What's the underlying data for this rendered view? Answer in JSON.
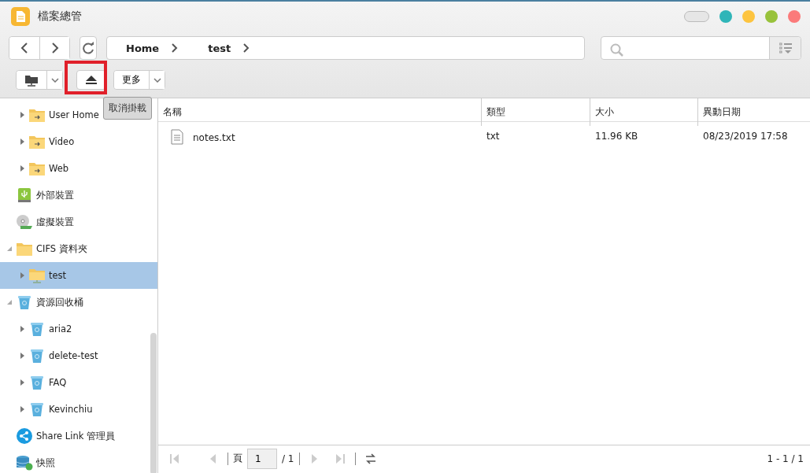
{
  "window": {
    "title": "檔案總管"
  },
  "breadcrumb": [
    "Home",
    "test"
  ],
  "toolbar": {
    "more_label": "更多",
    "tooltip": "取消掛載"
  },
  "sidebar": {
    "items": [
      {
        "children": [
          {
            "label": "User Home",
            "kind": "shared",
            "expanded": false,
            "selected": false
          },
          {
            "label": "Video",
            "kind": "shared",
            "expanded": false,
            "selected": false
          },
          {
            "label": "Web",
            "kind": "shared",
            "expanded": false,
            "selected": false
          }
        ]
      },
      {
        "label": "外部裝置",
        "kind": "usb",
        "selected": false
      },
      {
        "label": "虛擬裝置",
        "kind": "disc",
        "selected": false
      },
      {
        "label": "CIFS 資料夾",
        "kind": "folder",
        "expanded": true,
        "selected": false,
        "children": [
          {
            "label": "test",
            "kind": "mount",
            "expanded": false,
            "selected": true
          }
        ]
      },
      {
        "label": "資源回收桶",
        "kind": "bin",
        "expanded": true,
        "selected": false,
        "children": [
          {
            "label": "aria2",
            "kind": "bin",
            "expanded": false,
            "selected": false
          },
          {
            "label": "delete-test",
            "kind": "bin",
            "expanded": false,
            "selected": false
          },
          {
            "label": "FAQ",
            "kind": "bin",
            "expanded": false,
            "selected": false
          },
          {
            "label": "Kevinchiu",
            "kind": "bin",
            "expanded": false,
            "selected": false
          }
        ]
      },
      {
        "label": "Share Link 管理員",
        "kind": "share",
        "selected": false
      },
      {
        "label": "快照",
        "kind": "snapshot",
        "selected": false
      }
    ]
  },
  "table": {
    "columns": [
      "名稱",
      "類型",
      "大小",
      "異動日期"
    ],
    "rows": [
      {
        "cells": [
          "notes.txt",
          "txt",
          "11.96 KB",
          "08/23/2019 17:58"
        ],
        "selected": false
      }
    ]
  },
  "pager": {
    "page_label": "頁",
    "page": "1",
    "total": "/ 1",
    "summary": "1 - 1 / 1"
  }
}
